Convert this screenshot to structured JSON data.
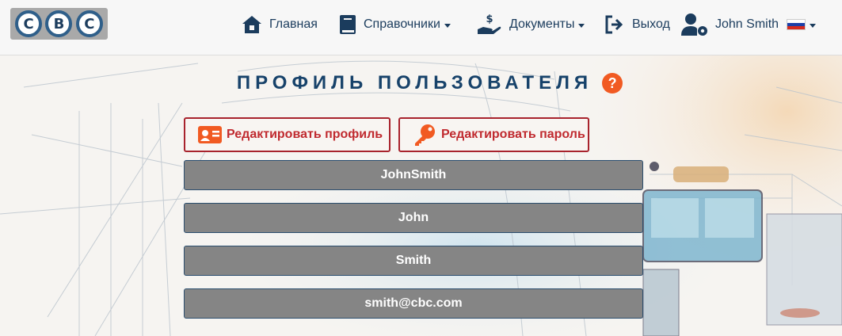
{
  "nav": {
    "logo_letters": [
      "C",
      "B",
      "C"
    ],
    "home_label": "Главная",
    "references_label": "Справочники",
    "documents_label": "Документы",
    "logout_label": "Выход",
    "user_name": "John Smith"
  },
  "page": {
    "title": "ПРОФИЛЬ ПОЛЬЗОВАТЕЛЯ",
    "help_glyph": "?",
    "edit_profile_label": "Редактировать профиль",
    "edit_password_label": "Редактировать пароль"
  },
  "profile": {
    "username": "JohnSmith",
    "first_name": "John",
    "last_name": "Smith",
    "email": "smith@cbc.com"
  },
  "colors": {
    "nav_text": "#1b3c5d",
    "accent_red": "#c02a2f",
    "help_orange": "#f15a22",
    "field_bg": "#858585"
  },
  "icons": [
    "home-icon",
    "book-icon",
    "hand-dollar-icon",
    "logout-icon",
    "user-gear-icon",
    "russia-flag-icon",
    "id-card-icon",
    "key-icon"
  ]
}
